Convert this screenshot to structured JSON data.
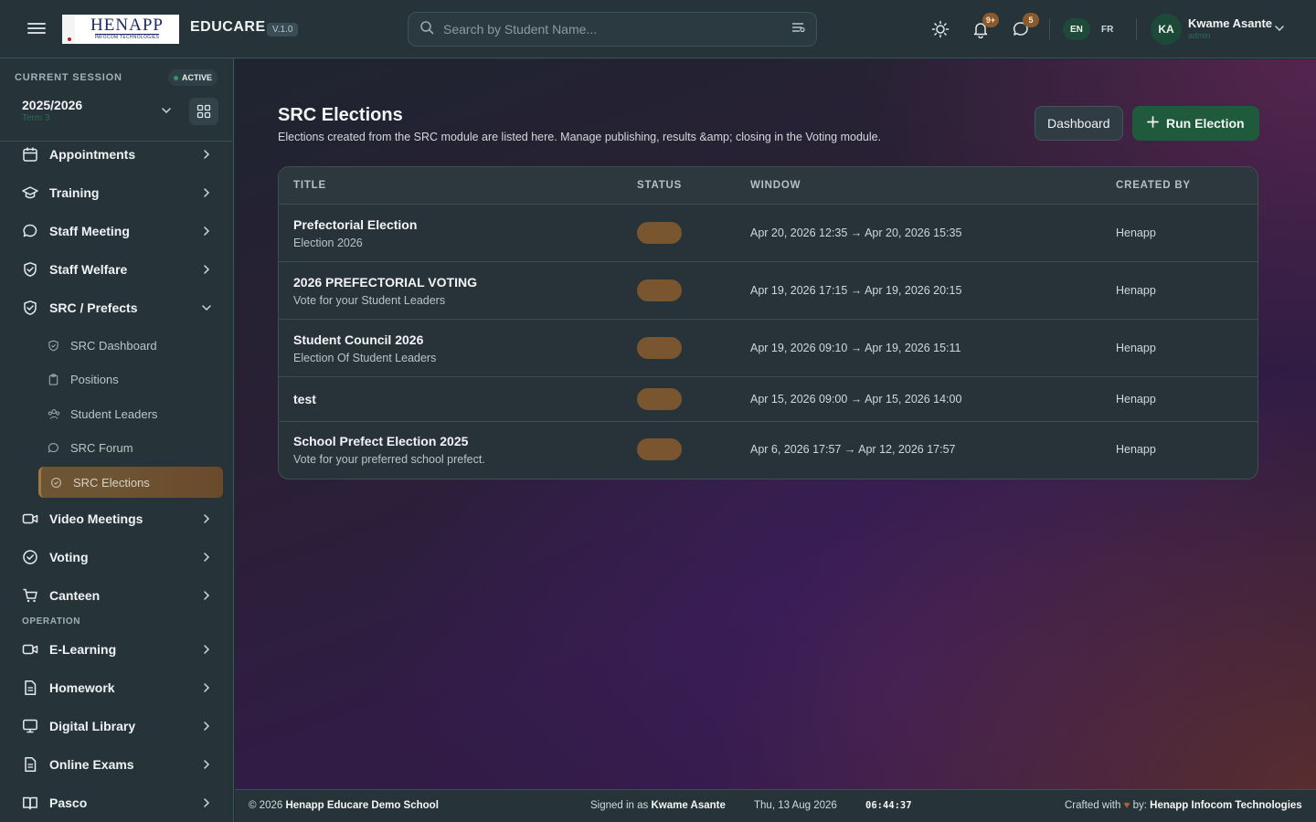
{
  "app": {
    "logo_text": "HENAPP",
    "logo_subtext": "INFOCOM TECHNOLOGIES",
    "name": "EDUCARE",
    "version": "V.1.0"
  },
  "header": {
    "search_placeholder": "Search by Student Name...",
    "notifications_badge": "9+",
    "messages_badge": "5",
    "languages": [
      "EN",
      "FR"
    ],
    "active_language": "EN",
    "user": {
      "initials": "KA",
      "name": "Kwame Asante",
      "role": "admin"
    }
  },
  "sidebar": {
    "session_label": "CURRENT SESSION",
    "session_status": "ACTIVE",
    "session_year": "2025/2026",
    "session_term": "Term 3",
    "items_top": [
      {
        "label": "Appointments",
        "icon": "calendar-icon"
      },
      {
        "label": "Training",
        "icon": "graduation-cap-icon"
      },
      {
        "label": "Staff Meeting",
        "icon": "chat-bubble-icon"
      },
      {
        "label": "Staff Welfare",
        "icon": "shield-check-icon"
      },
      {
        "label": "SRC / Prefects",
        "icon": "shield-check-icon",
        "expanded": true
      }
    ],
    "sub_items": [
      {
        "label": "SRC Dashboard",
        "icon": "shield-icon"
      },
      {
        "label": "Positions",
        "icon": "clipboard-icon"
      },
      {
        "label": "Student Leaders",
        "icon": "users-icon"
      },
      {
        "label": "SRC Forum",
        "icon": "chat-bubble-icon"
      },
      {
        "label": "SRC Elections",
        "icon": "check-circle-icon",
        "active": true
      }
    ],
    "items_bottom": [
      {
        "label": "Video Meetings",
        "icon": "video-icon"
      },
      {
        "label": "Voting",
        "icon": "check-circle-icon"
      },
      {
        "label": "Canteen",
        "icon": "cart-icon"
      }
    ],
    "section_operation": "OPERATION",
    "items_operation": [
      {
        "label": "E-Learning",
        "icon": "video-icon"
      },
      {
        "label": "Homework",
        "icon": "document-icon"
      },
      {
        "label": "Digital Library",
        "icon": "monitor-icon"
      },
      {
        "label": "Online Exams",
        "icon": "document-icon"
      },
      {
        "label": "Pasco",
        "icon": "book-icon"
      }
    ]
  },
  "main": {
    "title": "SRC Elections",
    "description": "Elections created from the SRC module are listed here. Manage publishing, results &amp; closing in the Voting module.",
    "btn_dashboard": "Dashboard",
    "btn_run": "Run Election",
    "table": {
      "headers": [
        "TITLE",
        "STATUS",
        "WINDOW",
        "CREATED BY"
      ],
      "rows": [
        {
          "title": "Prefectorial Election",
          "subtitle": "Election 2026",
          "window": "Apr 20, 2026 12:35 → Apr 20, 2026 15:35",
          "created_by": "Henapp"
        },
        {
          "title": "2026 PREFECTORIAL VOTING",
          "subtitle": "Vote for your Student Leaders",
          "window": "Apr 19, 2026 17:15 → Apr 19, 2026 20:15",
          "created_by": "Henapp"
        },
        {
          "title": "Student Council 2026",
          "subtitle": "Election Of Student Leaders",
          "window": "Apr 19, 2026 09:10 → Apr 19, 2026 15:11",
          "created_by": "Henapp"
        },
        {
          "title": "test",
          "subtitle": "",
          "window": "Apr 15, 2026 09:00 → Apr 15, 2026 14:00",
          "created_by": "Henapp"
        },
        {
          "title": "School Prefect Election 2025",
          "subtitle": "Vote for your preferred school prefect.",
          "window": "Apr 6, 2026 17:57 → Apr 12, 2026 17:57",
          "created_by": "Henapp"
        }
      ]
    }
  },
  "footer": {
    "copyright_prefix": "© 2026",
    "school": "Henapp Educare Demo School",
    "signed_in_prefix": "Signed in as",
    "signed_in_user": "Kwame Asante",
    "date": "Thu, 13 Aug 2026",
    "time": "06:44:37",
    "crafted_prefix": "Crafted with",
    "crafted_suffix": "by:",
    "company": "Henapp Infocom Technologies"
  },
  "colors": {
    "accent_green": "#1f5a3c",
    "status_pill": "#7a5630",
    "active_sub_item": "#6d5433"
  }
}
